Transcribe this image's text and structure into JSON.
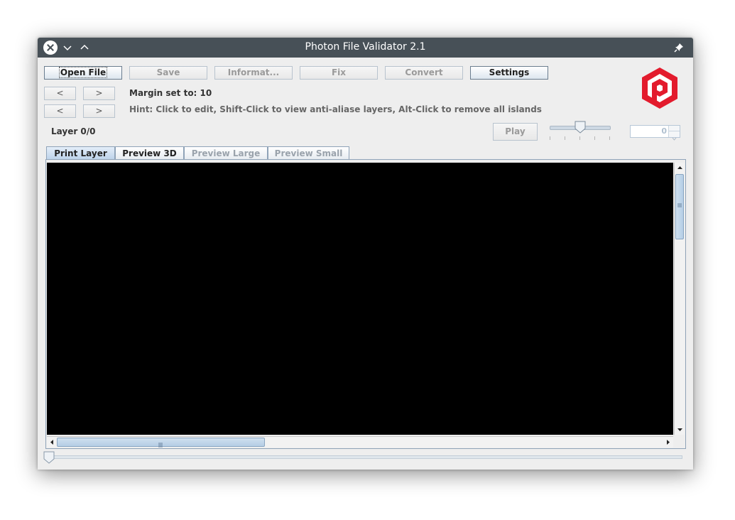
{
  "window": {
    "title": "Photon File Validator 2.1"
  },
  "toolbar": {
    "open_file": "Open File",
    "save": "Save",
    "information": "Informat...",
    "fix": "Fix",
    "convert": "Convert",
    "settings": "Settings"
  },
  "margin": {
    "prev": "<",
    "next": ">",
    "text": "Margin set to: 10"
  },
  "hint": {
    "prev": "<",
    "next": ">",
    "text": "Hint: Click to edit, Shift-Click to view anti-aliase layers, Alt-Click to remove all islands"
  },
  "layer": {
    "label": "Layer 0/0"
  },
  "playback": {
    "play_label": "Play",
    "speed_slider_value": 0.5,
    "spinner_value": "0"
  },
  "tabs": [
    {
      "label": "Print Layer",
      "state": "selected"
    },
    {
      "label": "Preview 3D",
      "state": "enabled"
    },
    {
      "label": "Preview Large",
      "state": "disabled"
    },
    {
      "label": "Preview Small",
      "state": "disabled"
    }
  ],
  "layer_slider": {
    "value": 0
  },
  "colors": {
    "titlebar": "#475057",
    "logo": "#e31b2d",
    "canvas": "#000000",
    "accent": "#b9d0e8"
  },
  "icons": {
    "close": "close-icon",
    "minimize": "chevron-down-icon",
    "maximize": "chevron-up-icon",
    "pin": "pin-icon",
    "logo": "photon-logo"
  }
}
